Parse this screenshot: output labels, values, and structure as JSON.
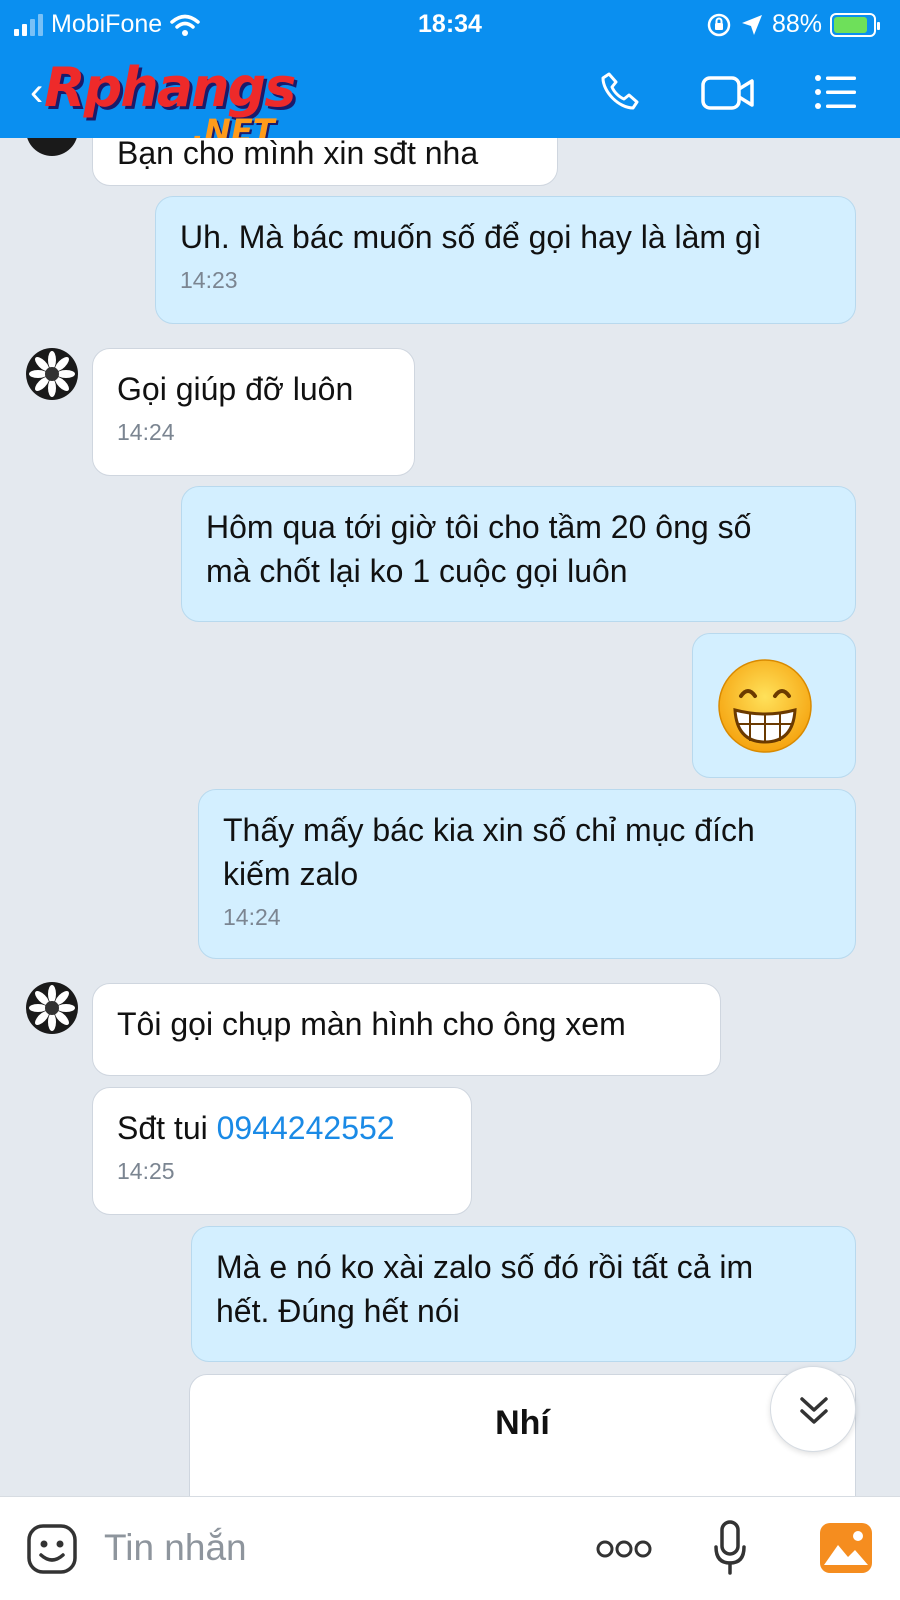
{
  "status_bar": {
    "carrier": "MobiFone",
    "time": "18:34",
    "battery": "88%",
    "battery_level": 0.88
  },
  "header": {
    "logo_main": "Rphangs",
    "logo_sub": ".NET"
  },
  "messages": [
    {
      "text": "Bạn cho mình xin sđt nha"
    },
    {
      "text": "Uh. Mà bác muốn số để gọi hay là làm gì",
      "time": "14:23"
    },
    {
      "text": "Gọi giúp đỡ luôn",
      "time": "14:24"
    },
    {
      "text_line1": "Hôm qua tới giờ tôi cho tầm 20 ông số",
      "text_line2": "mà chốt lại ko 1 cuộc gọi luôn"
    },
    {
      "sticker": "grinning-face-emoji"
    },
    {
      "text_line1": "Thấy mấy bác kia xin số chỉ mục đích",
      "text_line2": "kiếm zalo",
      "time": "14:24"
    },
    {
      "text": "Tôi gọi chụp màn hình cho ông xem"
    },
    {
      "text": "Sđt tui ",
      "phone": "0944242552",
      "time": "14:25"
    },
    {
      "text_line1": "Mà e nó ko xài zalo số đó rồi tất cả im",
      "text_line2": "hết. Đúng hết nói"
    },
    {
      "text": "Nhí"
    }
  ],
  "input": {
    "placeholder": "Tin nhắn"
  },
  "colors": {
    "header": "#0a8ff0",
    "incoming": "#ffffff",
    "outgoing": "#d3efff",
    "link": "#1a8ae6",
    "background": "#e4e9ef"
  }
}
